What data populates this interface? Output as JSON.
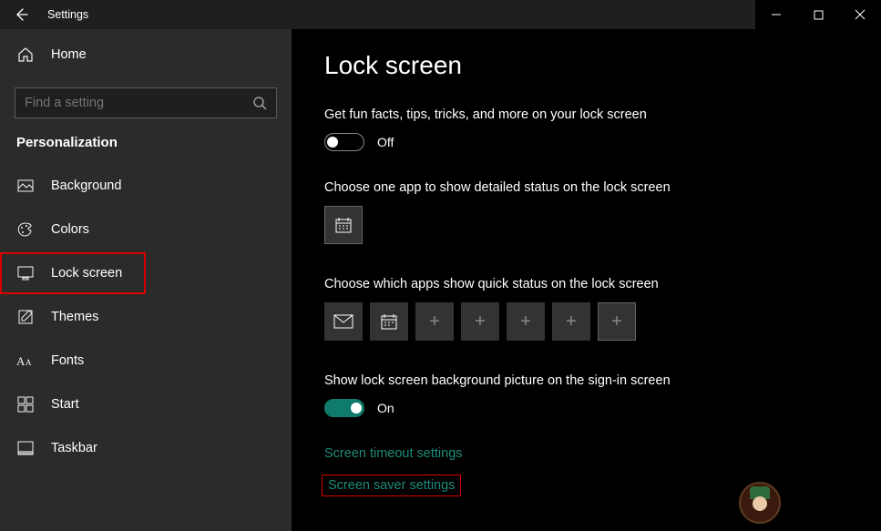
{
  "window": {
    "app_title": "Settings"
  },
  "sidebar": {
    "home_label": "Home",
    "search_placeholder": "Find a setting",
    "section": "Personalization",
    "items": [
      {
        "label": "Background"
      },
      {
        "label": "Colors"
      },
      {
        "label": "Lock screen"
      },
      {
        "label": "Themes"
      },
      {
        "label": "Fonts"
      },
      {
        "label": "Start"
      },
      {
        "label": "Taskbar"
      }
    ]
  },
  "main": {
    "title": "Lock screen",
    "fun_facts_label": "Get fun facts, tips, tricks, and more on your lock screen",
    "fun_facts_state": "Off",
    "detailed_status_label": "Choose one app to show detailed status on the lock screen",
    "quick_status_label": "Choose which apps show quick status on the lock screen",
    "show_bg_label": "Show lock screen background picture on the sign-in screen",
    "show_bg_state": "On",
    "link_timeout": "Screen timeout settings",
    "link_saver": "Screen saver settings"
  }
}
